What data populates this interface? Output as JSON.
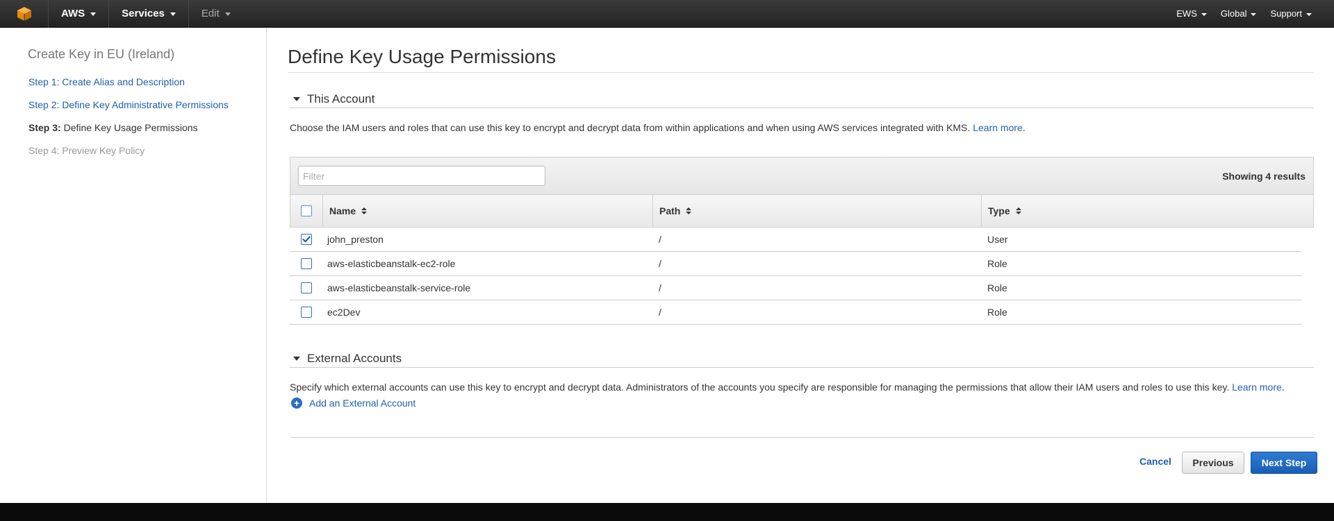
{
  "nav": {
    "brand": "AWS",
    "services": "Services",
    "edit": "Edit",
    "account": "EWS",
    "region": "Global",
    "support": "Support",
    "logo_color": "#f49b1e"
  },
  "sidebar": {
    "title": "Create Key in EU (Ireland)",
    "steps": [
      {
        "label": "Step 1: Create Alias and Description",
        "state": "done"
      },
      {
        "label": "Step 2: Define Key Administrative Permissions",
        "state": "done"
      },
      {
        "prefix": "Step 3:",
        "label": "Define Key Usage Permissions",
        "state": "current"
      },
      {
        "label": "Step 4: Preview Key Policy",
        "state": "disabled"
      }
    ]
  },
  "main": {
    "title": "Define Key Usage Permissions",
    "this_account": {
      "heading": "This Account",
      "description": "Choose the IAM users and roles that can use this key to encrypt and decrypt data from within applications and when using AWS services integrated with KMS.",
      "learn_more": "Learn more",
      "filter_placeholder": "Filter",
      "showing": "Showing 4 results",
      "columns": [
        "Name",
        "Path",
        "Type"
      ],
      "rows": [
        {
          "name": "john_preston",
          "path": "/",
          "type": "User",
          "checked": true
        },
        {
          "name": "aws-elasticbeanstalk-ec2-role",
          "path": "/",
          "type": "Role",
          "checked": false
        },
        {
          "name": "aws-elasticbeanstalk-service-role",
          "path": "/",
          "type": "Role",
          "checked": false
        },
        {
          "name": "ec2Dev",
          "path": "/",
          "type": "Role",
          "checked": false
        }
      ]
    },
    "external": {
      "heading": "External Accounts",
      "description": "Specify which external accounts can use this key to encrypt and decrypt data. Administrators of the accounts you specify are responsible for managing the permissions that allow their IAM users and roles to use this key.",
      "learn_more": "Learn more",
      "add_label": "Add an External Account"
    },
    "buttons": {
      "cancel": "Cancel",
      "previous": "Previous",
      "next": "Next Step"
    }
  }
}
